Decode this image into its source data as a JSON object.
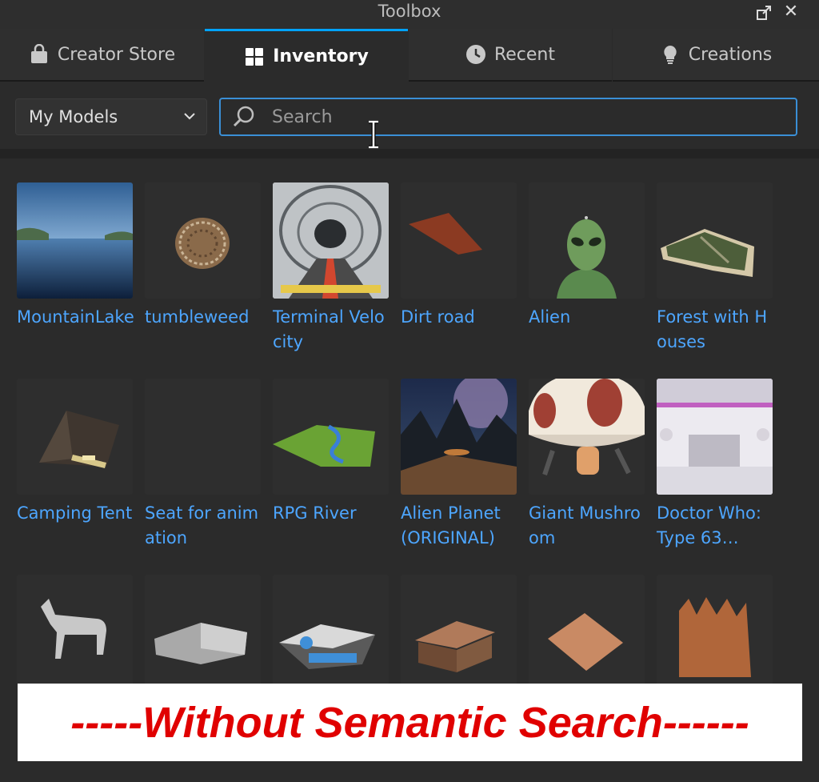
{
  "window": {
    "title": "Toolbox"
  },
  "tabs": [
    {
      "label": "Creator Store",
      "icon": "bag-icon",
      "active": false
    },
    {
      "label": "Inventory",
      "icon": "grid-icon",
      "active": true
    },
    {
      "label": "Recent",
      "icon": "clock-icon",
      "active": false
    },
    {
      "label": "Creations",
      "icon": "lightbulb-icon",
      "active": false
    }
  ],
  "filter": {
    "selected": "My Models"
  },
  "search": {
    "placeholder": "Search",
    "value": ""
  },
  "items": [
    {
      "name": "MountainLake",
      "thumb": "lake"
    },
    {
      "name": "tumbleweed",
      "thumb": "tumbleweed"
    },
    {
      "name": "Terminal Velocity",
      "thumb": "tunnel"
    },
    {
      "name": "Dirt road",
      "thumb": "dirt"
    },
    {
      "name": "Alien",
      "thumb": "alien"
    },
    {
      "name": "Forest with Houses",
      "thumb": "forest"
    },
    {
      "name": "Camping Tent",
      "thumb": "tent"
    },
    {
      "name": "Seat for animation",
      "thumb": "empty"
    },
    {
      "name": "RPG River",
      "thumb": "river"
    },
    {
      "name": "Alien Planet (ORIGINAL)",
      "thumb": "planet"
    },
    {
      "name": "Giant Mushroom",
      "thumb": "mushroom"
    },
    {
      "name": "Doctor Who: Type 63…",
      "thumb": "tardis"
    },
    {
      "name": "",
      "thumb": "horse"
    },
    {
      "name": "",
      "thumb": "building"
    },
    {
      "name": "",
      "thumb": "station"
    },
    {
      "name": "",
      "thumb": "house"
    },
    {
      "name": "",
      "thumb": "plate"
    },
    {
      "name": "",
      "thumb": "castle"
    }
  ],
  "banner": {
    "text": "-----Without Semantic Search------"
  },
  "colors": {
    "accent": "#00a2ff",
    "link": "#4da6ff",
    "banner_text": "#e00000"
  }
}
